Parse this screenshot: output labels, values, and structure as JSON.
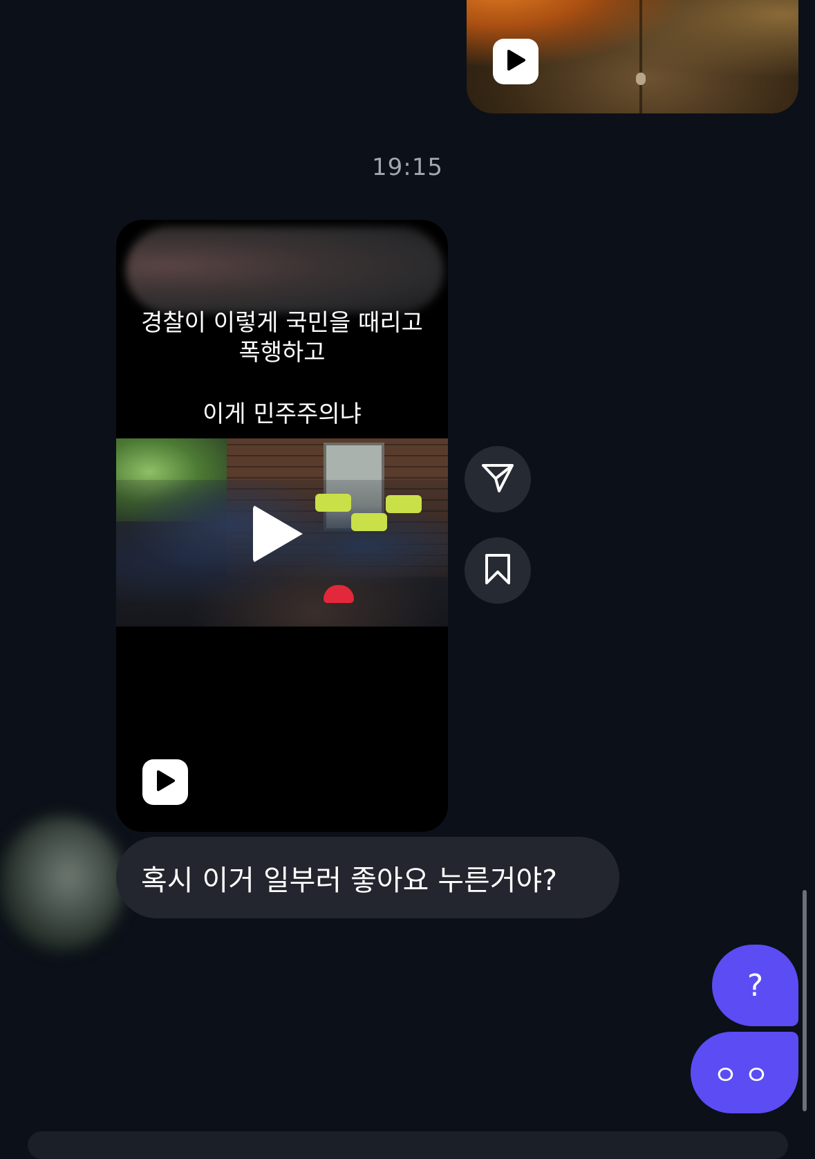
{
  "top_video": {
    "kind": "video-message",
    "badge_icon": "play-icon"
  },
  "timestamp": "19:15",
  "reel": {
    "caption_line1": "경찰이 이렇게 국민을 때리고\n폭행하고",
    "caption_line2": "이게 민주주의냐",
    "center_icon": "play-icon",
    "badge_icon": "play-icon"
  },
  "side_actions": [
    {
      "name": "share",
      "icon": "paper-plane-icon"
    },
    {
      "name": "save",
      "icon": "bookmark-icon"
    }
  ],
  "incoming_message": "혹시 이거 일부러 좋아요 누른거야?",
  "outgoing_messages": [
    "?",
    "ㅇㅇ"
  ],
  "colors": {
    "background": "#0c1018",
    "incoming_bubble": "#23262e",
    "outgoing_bubble": "#5b4cf3",
    "timestamp_text": "#a3a8b0"
  }
}
